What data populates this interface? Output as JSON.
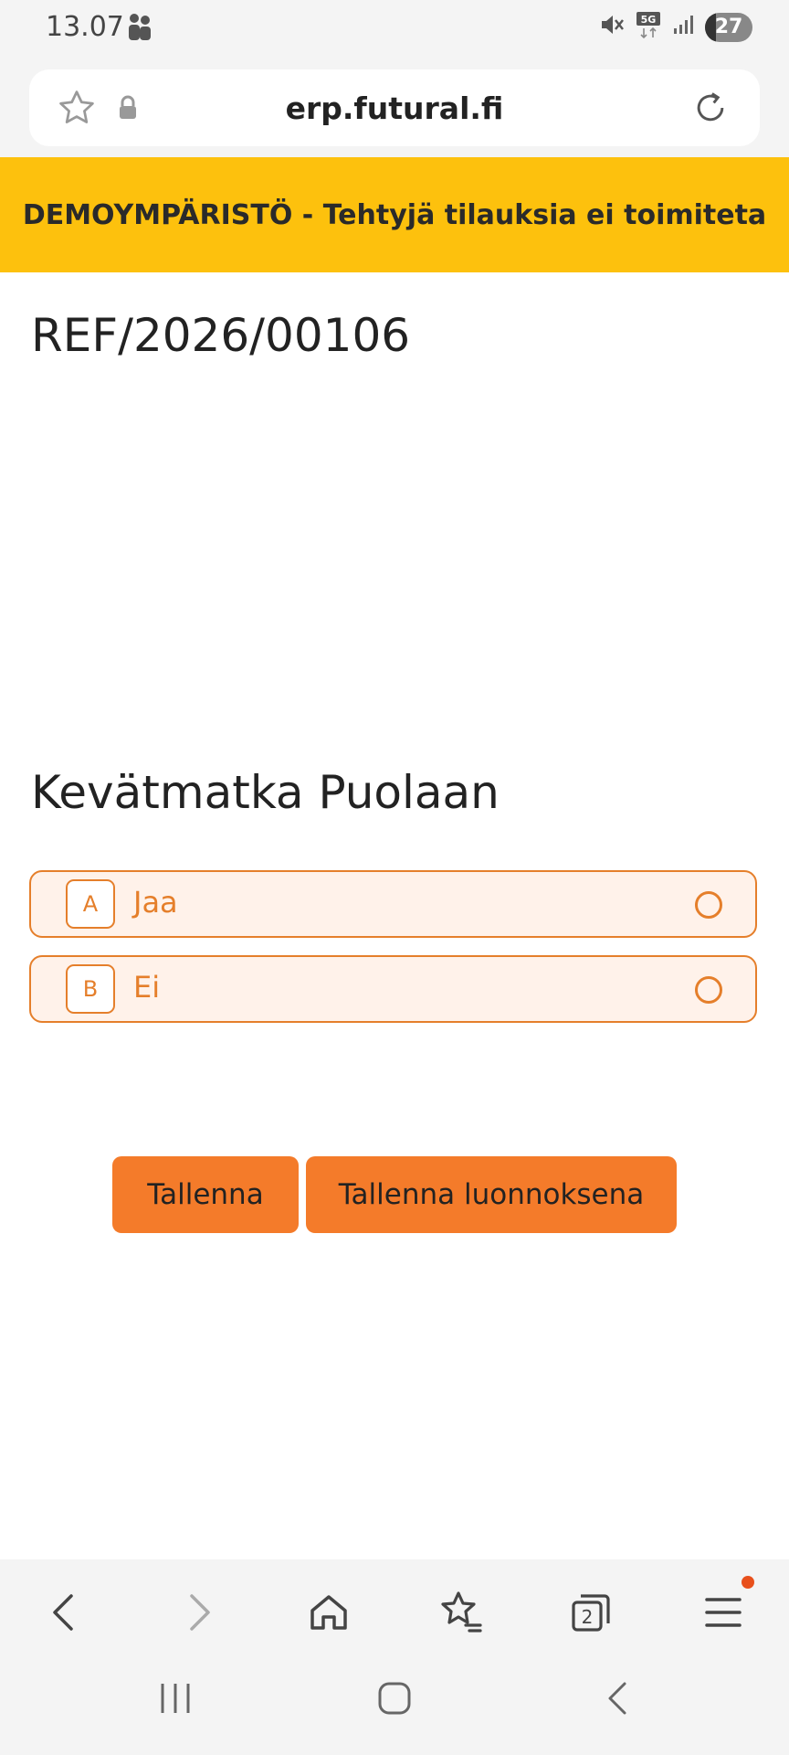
{
  "status_bar": {
    "time": "13.07",
    "battery": "27"
  },
  "address_bar": {
    "url": "erp.futural.fi"
  },
  "banner": {
    "text": "DEMOYMPÄRISTÖ - Tehtyjä tilauksia ei toimiteta"
  },
  "form": {
    "reference": "REF/2026/00106",
    "question": "Kevätmatka Puolaan",
    "options": [
      {
        "letter": "A",
        "label": "Jaa"
      },
      {
        "letter": "B",
        "label": "Ei"
      }
    ],
    "save_label": "Tallenna",
    "save_draft_label": "Tallenna luonnoksena"
  },
  "bottom_nav": {
    "tabs_count": "2"
  },
  "colors": {
    "banner": "#fdc10d",
    "accent": "#f47b2a",
    "option_border": "#e57f2b",
    "option_background": "#fff2ea"
  },
  "icons": {
    "status_bar": [
      "people-icon",
      "mute-icon",
      "5g-icon",
      "signal-icon",
      "battery-icon"
    ],
    "address_bar": [
      "star-icon",
      "lock-icon",
      "reload-icon"
    ],
    "bottom_nav": [
      "back-icon",
      "forward-icon",
      "home-icon",
      "bookmarks-icon",
      "tabs-icon",
      "menu-icon"
    ],
    "system_nav": [
      "recents-icon",
      "home-button-icon",
      "system-back-icon"
    ]
  }
}
